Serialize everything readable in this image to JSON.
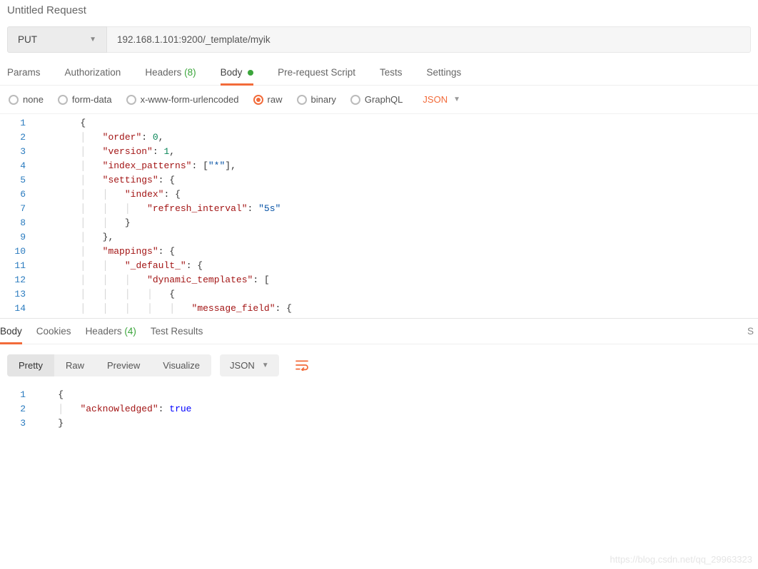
{
  "request_title": "Untitled Request",
  "method": "PUT",
  "url": "192.168.1.101:9200/_template/myik",
  "tabs": {
    "params": {
      "label": "Params"
    },
    "auth": {
      "label": "Authorization"
    },
    "headers": {
      "label": "Headers",
      "count": "(8)"
    },
    "body": {
      "label": "Body"
    },
    "prereq": {
      "label": "Pre-request Script"
    },
    "tests": {
      "label": "Tests"
    },
    "settings": {
      "label": "Settings"
    }
  },
  "body_types": {
    "none": "none",
    "formdata": "form-data",
    "xwww": "x-www-form-urlencoded",
    "raw": "raw",
    "binary": "binary",
    "graphql": "GraphQL",
    "format_label": "JSON"
  },
  "request_body_lines": [
    [
      {
        "t": "brace",
        "v": "{"
      }
    ],
    [
      {
        "t": "pad",
        "v": "    "
      },
      {
        "t": "key",
        "v": "\"order\""
      },
      {
        "t": "colon",
        "v": ": "
      },
      {
        "t": "num",
        "v": "0"
      },
      {
        "t": "brace",
        "v": ","
      }
    ],
    [
      {
        "t": "pad",
        "v": "    "
      },
      {
        "t": "key",
        "v": "\"version\""
      },
      {
        "t": "colon",
        "v": ": "
      },
      {
        "t": "num",
        "v": "1"
      },
      {
        "t": "brace",
        "v": ","
      }
    ],
    [
      {
        "t": "pad",
        "v": "    "
      },
      {
        "t": "key",
        "v": "\"index_patterns\""
      },
      {
        "t": "colon",
        "v": ": ["
      },
      {
        "t": "str",
        "v": "\"*\""
      },
      {
        "t": "brace",
        "v": "],"
      }
    ],
    [
      {
        "t": "pad",
        "v": "    "
      },
      {
        "t": "key",
        "v": "\"settings\""
      },
      {
        "t": "colon",
        "v": ": {"
      }
    ],
    [
      {
        "t": "pad",
        "v": "        "
      },
      {
        "t": "key",
        "v": "\"index\""
      },
      {
        "t": "colon",
        "v": ": {"
      }
    ],
    [
      {
        "t": "pad",
        "v": "            "
      },
      {
        "t": "key",
        "v": "\"refresh_interval\""
      },
      {
        "t": "colon",
        "v": ": "
      },
      {
        "t": "str",
        "v": "\"5s\""
      }
    ],
    [
      {
        "t": "pad",
        "v": "        "
      },
      {
        "t": "brace",
        "v": "}"
      }
    ],
    [
      {
        "t": "pad",
        "v": "    "
      },
      {
        "t": "brace",
        "v": "},"
      }
    ],
    [
      {
        "t": "pad",
        "v": "    "
      },
      {
        "t": "key",
        "v": "\"mappings\""
      },
      {
        "t": "colon",
        "v": ": {"
      }
    ],
    [
      {
        "t": "pad",
        "v": "        "
      },
      {
        "t": "key",
        "v": "\"_default_\""
      },
      {
        "t": "colon",
        "v": ": {"
      }
    ],
    [
      {
        "t": "pad",
        "v": "            "
      },
      {
        "t": "key",
        "v": "\"dynamic_templates\""
      },
      {
        "t": "colon",
        "v": ": ["
      }
    ],
    [
      {
        "t": "pad",
        "v": "                "
      },
      {
        "t": "brace",
        "v": "{"
      }
    ],
    [
      {
        "t": "pad",
        "v": "                    "
      },
      {
        "t": "key",
        "v": "\"message_field\""
      },
      {
        "t": "colon",
        "v": ": {"
      }
    ]
  ],
  "response_tabs": {
    "body": {
      "label": "Body"
    },
    "cookies": {
      "label": "Cookies"
    },
    "headers": {
      "label": "Headers",
      "count": "(4)"
    },
    "results": {
      "label": "Test Results"
    },
    "status_initial": "S"
  },
  "response_toolbar": {
    "pretty": "Pretty",
    "raw": "Raw",
    "preview": "Preview",
    "visualize": "Visualize",
    "format": "JSON"
  },
  "response_body_lines": [
    [
      {
        "t": "brace",
        "v": "{"
      }
    ],
    [
      {
        "t": "pad",
        "v": "    "
      },
      {
        "t": "key",
        "v": "\"acknowledged\""
      },
      {
        "t": "colon",
        "v": ": "
      },
      {
        "t": "bool",
        "v": "true"
      }
    ],
    [
      {
        "t": "brace",
        "v": "}"
      }
    ]
  ],
  "watermark": "https://blog.csdn.net/qq_29963323"
}
